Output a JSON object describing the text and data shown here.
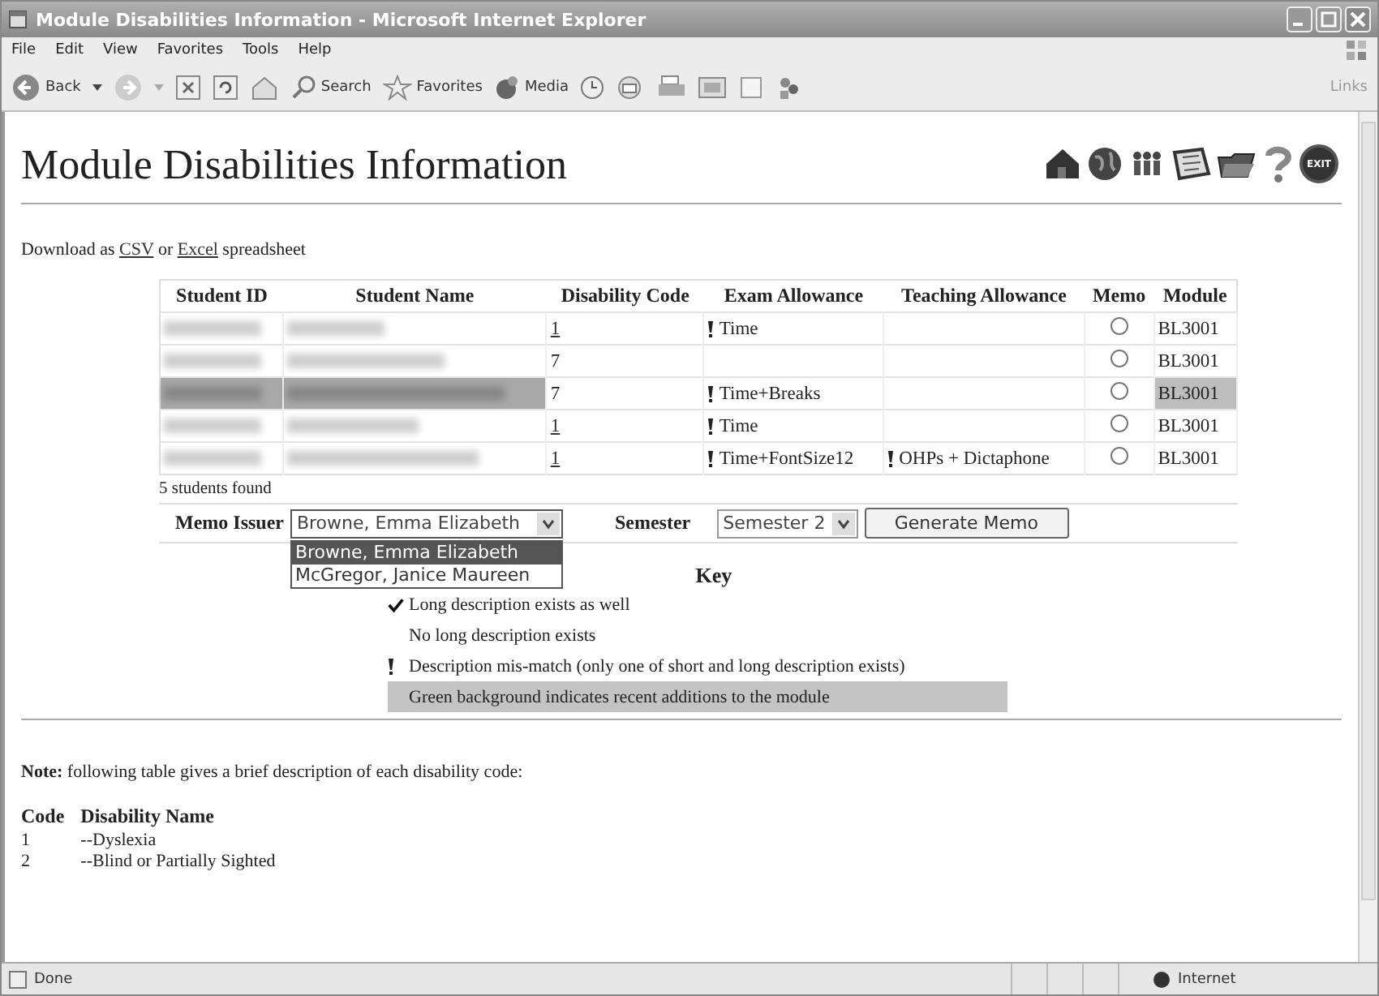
{
  "window": {
    "title": "Module Disabilities Information - Microsoft Internet Explorer"
  },
  "menu": [
    "File",
    "Edit",
    "View",
    "Favorites",
    "Tools",
    "Help"
  ],
  "toolbar": {
    "back": "Back",
    "search": "Search",
    "favorites": "Favorites",
    "media": "Media",
    "links": "Links"
  },
  "page": {
    "title": "Module Disabilities Information",
    "exit_label": "EXIT",
    "download": {
      "before": "Download as",
      "csv": "CSV",
      "middle": "or",
      "excel": "Excel",
      "after": "spreadsheet"
    },
    "table": {
      "columns": [
        "Student ID",
        "Student Name",
        "Disability Code",
        "Exam Allowance",
        "Teaching Allowance",
        "Memo",
        "Module"
      ],
      "rows": [
        {
          "recent": false,
          "code": "1",
          "code_link": true,
          "exam": "Time",
          "exam_mismatch": true,
          "memo_selected": false,
          "module": "BL3001"
        },
        {
          "recent": false,
          "code": "7",
          "code_link": false,
          "memo_selected": false,
          "module": "BL3001"
        },
        {
          "recent": true,
          "code": "7",
          "code_link": false,
          "exam": "Time+Breaks",
          "exam_mismatch": true,
          "memo_selected": false,
          "module": "BL3001"
        },
        {
          "recent": false,
          "code": "1",
          "code_link": true,
          "exam": "Time",
          "exam_mismatch": true,
          "memo_selected": false,
          "module": "BL3001"
        },
        {
          "recent": false,
          "code": "1",
          "code_link": true,
          "exam": "Time+FontSize12",
          "exam_mismatch": true,
          "teaching": "OHPs + Dictaphone",
          "teaching_mismatch": true,
          "memo_selected": false,
          "module": "BL3001"
        }
      ],
      "count": "5 students found"
    },
    "memo_form": {
      "issuer_label": "Memo Issuer",
      "issuer_value": "Browne, Emma Elizabeth",
      "expanded": true,
      "options": [
        {
          "label": "Browne, Emma Elizabeth",
          "selected": true
        },
        {
          "label": "McGregor, Janice Maureen",
          "selected": false
        }
      ],
      "semester_label": "Semester",
      "semester_value": "Semester 2",
      "button": "Generate Memo"
    },
    "key": {
      "title": "Key",
      "items": [
        {
          "kind": "check",
          "text": "Long description exists as well"
        },
        {
          "kind": "plain",
          "text": "No long description exists"
        },
        {
          "kind": "mismatch",
          "text": "Description mis-match (only one of short and long description exists)"
        },
        {
          "kind": "recent",
          "text": "Green background indicates recent additions to the module"
        }
      ]
    },
    "note": "**Note:** following table gives a brief description of each disability code:",
    "codes": {
      "columns": [
        "Code",
        "Disability Name"
      ],
      "rows": [
        {
          "code": "1",
          "name": "--Dyslexia"
        },
        {
          "code": "2",
          "name": "--Blind or Partially Sighted"
        }
      ]
    }
  },
  "status_bar": {
    "text": "Done",
    "zone": "Internet"
  }
}
